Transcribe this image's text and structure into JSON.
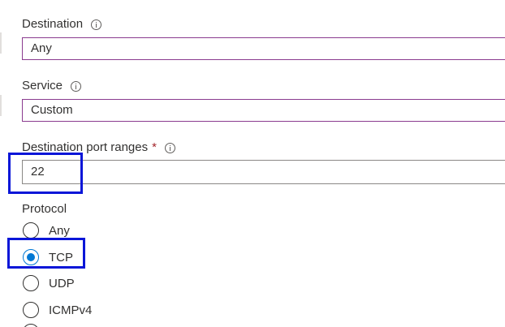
{
  "destination": {
    "label": "Destination",
    "value": "Any"
  },
  "service": {
    "label": "Service",
    "value": "Custom"
  },
  "destination_port_ranges": {
    "label": "Destination port ranges",
    "required_marker": "*",
    "value": "22"
  },
  "protocol": {
    "label": "Protocol",
    "options": [
      "Any",
      "TCP",
      "UDP",
      "ICMPv4"
    ],
    "selected": "TCP"
  },
  "icons": {
    "info": "info-icon",
    "radio": "radio-button"
  },
  "colors": {
    "select_border": "#8a3b8f",
    "input_border": "#8a8886",
    "radio_selected": "#0078d4",
    "highlight": "#0a16d8",
    "required": "#a4262c",
    "text": "#323130"
  }
}
